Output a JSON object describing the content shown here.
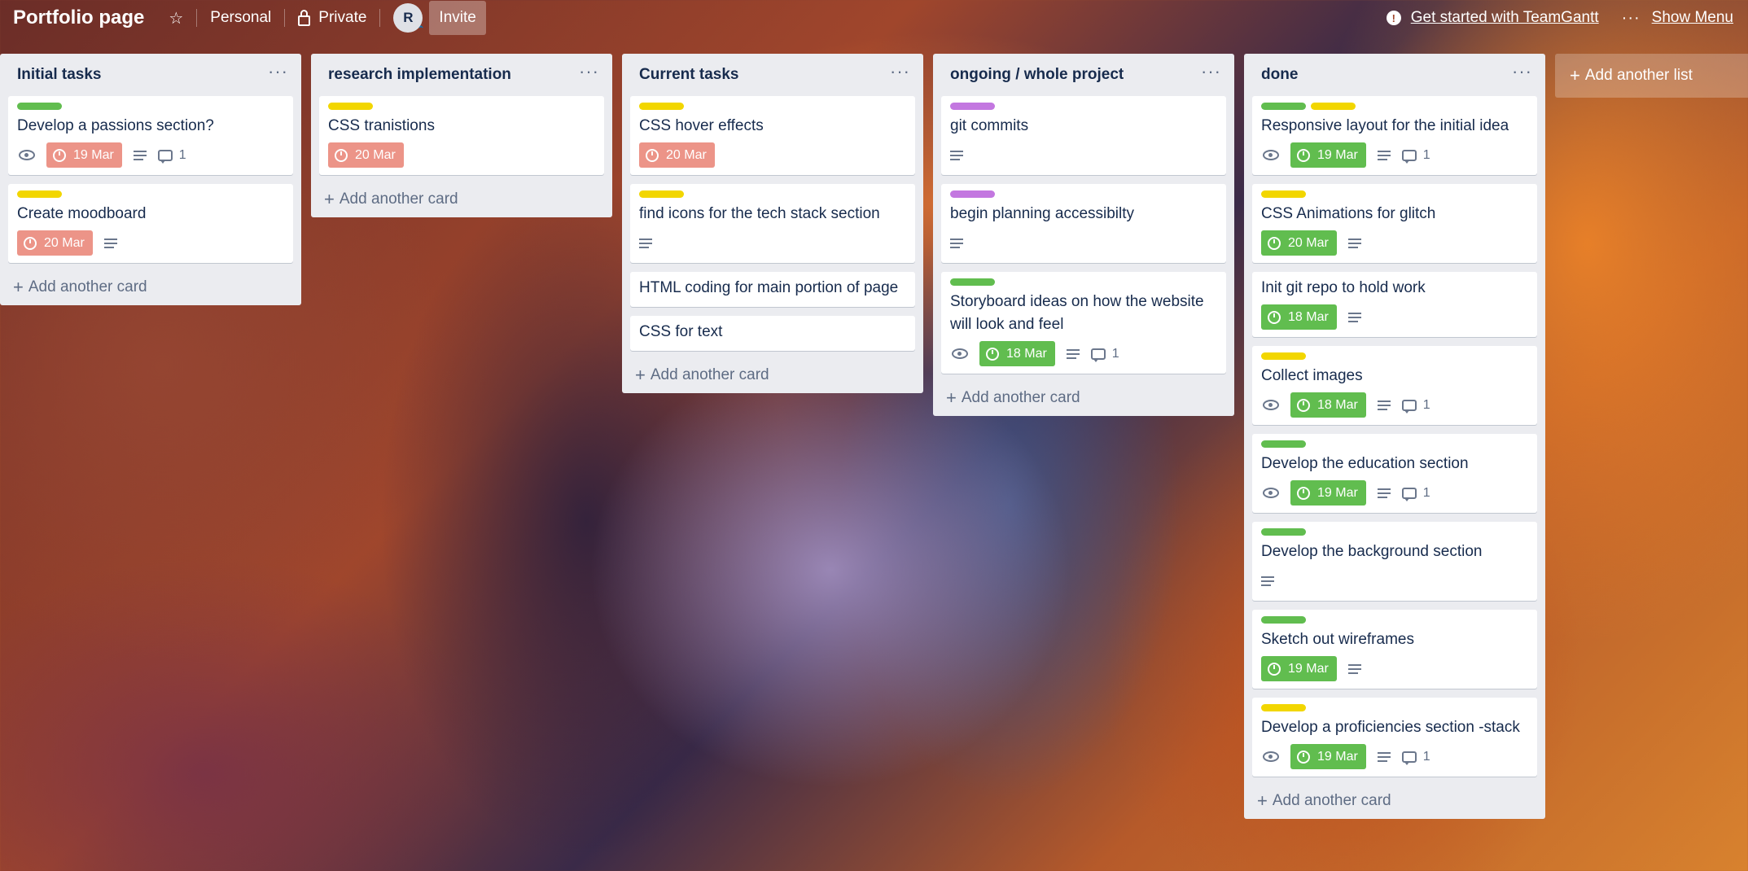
{
  "header": {
    "board_title": "Portfolio page",
    "star_icon": "star-icon",
    "team": "Personal",
    "visibility": "Private",
    "avatar_initial": "R",
    "invite": "Invite",
    "alert_icon": "!",
    "get_started": "Get started with TeamGantt",
    "menu_dots": "···",
    "show_menu": "Show Menu"
  },
  "colors": {
    "green": "#61bd4f",
    "yellow": "#f2d600",
    "purple": "#c377e0",
    "overdue": "#ec9488",
    "done": "#61bd4f"
  },
  "add_list": "Add another list",
  "add_card": "Add another card",
  "lists": [
    {
      "title": "Initial tasks",
      "cards": [
        {
          "title": "Develop a passions section?",
          "labels": [
            "green"
          ],
          "watch": true,
          "due": "19 Mar",
          "due_status": "overdue",
          "description": true,
          "comments": "1"
        },
        {
          "title": "Create moodboard",
          "labels": [
            "yellow"
          ],
          "watch": false,
          "due": "20 Mar",
          "due_status": "overdue",
          "description": true,
          "comments": null
        }
      ]
    },
    {
      "title": "research implementation",
      "cards": [
        {
          "title": "CSS tranistions",
          "labels": [
            "yellow"
          ],
          "watch": false,
          "due": "20 Mar",
          "due_status": "overdue",
          "description": false,
          "comments": null
        }
      ]
    },
    {
      "title": "Current tasks",
      "cards": [
        {
          "title": "CSS hover effects",
          "labels": [
            "yellow"
          ],
          "watch": false,
          "due": "20 Mar",
          "due_status": "overdue",
          "description": false,
          "comments": null
        },
        {
          "title": "find icons for the tech stack section",
          "labels": [
            "yellow"
          ],
          "watch": false,
          "due": null,
          "due_status": null,
          "description": true,
          "comments": null
        },
        {
          "title": "HTML coding for main portion of page",
          "labels": [],
          "watch": false,
          "due": null,
          "due_status": null,
          "description": false,
          "comments": null
        },
        {
          "title": "CSS for text",
          "labels": [],
          "watch": false,
          "due": null,
          "due_status": null,
          "description": false,
          "comments": null
        }
      ]
    },
    {
      "title": "ongoing / whole project",
      "cards": [
        {
          "title": "git commits",
          "labels": [
            "purple"
          ],
          "watch": false,
          "due": null,
          "due_status": null,
          "description": true,
          "comments": null
        },
        {
          "title": "begin planning accessibilty",
          "labels": [
            "purple"
          ],
          "watch": false,
          "due": null,
          "due_status": null,
          "description": true,
          "comments": null
        },
        {
          "title": "Storyboard ideas on how the website will look and feel",
          "labels": [
            "green"
          ],
          "watch": true,
          "due": "18 Mar",
          "due_status": "done",
          "description": true,
          "comments": "1"
        }
      ]
    },
    {
      "title": "done",
      "cards": [
        {
          "title": "Responsive layout for the initial idea",
          "labels": [
            "green",
            "yellow"
          ],
          "watch": true,
          "due": "19 Mar",
          "due_status": "done",
          "description": true,
          "comments": "1"
        },
        {
          "title": "CSS Animations for glitch",
          "labels": [
            "yellow"
          ],
          "watch": false,
          "due": "20 Mar",
          "due_status": "done",
          "description": true,
          "comments": null
        },
        {
          "title": "Init git repo to hold work",
          "labels": [],
          "watch": false,
          "due": "18 Mar",
          "due_status": "done",
          "description": true,
          "comments": null
        },
        {
          "title": "Collect images",
          "labels": [
            "yellow"
          ],
          "watch": true,
          "due": "18 Mar",
          "due_status": "done",
          "description": true,
          "comments": "1"
        },
        {
          "title": "Develop the education section",
          "labels": [
            "green"
          ],
          "watch": true,
          "due": "19 Mar",
          "due_status": "done",
          "description": true,
          "comments": "1"
        },
        {
          "title": "Develop the background section",
          "labels": [
            "green"
          ],
          "watch": false,
          "due": null,
          "due_status": null,
          "description": true,
          "comments": null
        },
        {
          "title": "Sketch out wireframes",
          "labels": [
            "green"
          ],
          "watch": false,
          "due": "19 Mar",
          "due_status": "done",
          "description": true,
          "comments": null
        },
        {
          "title": "Develop a proficiencies section -stack",
          "labels": [
            "yellow"
          ],
          "watch": true,
          "due": "19 Mar",
          "due_status": "done",
          "description": true,
          "comments": "1"
        }
      ]
    }
  ]
}
